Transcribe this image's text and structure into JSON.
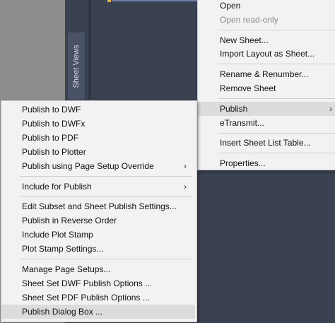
{
  "sheet_views_tab": "Sheet Views",
  "context_menu": {
    "items": [
      {
        "label": "Open"
      },
      {
        "label": "Open read-only"
      },
      {
        "label": "New Sheet..."
      },
      {
        "label": "Import Layout as Sheet..."
      },
      {
        "label": "Rename & Renumber..."
      },
      {
        "label": "Remove Sheet"
      },
      {
        "label": "Publish"
      },
      {
        "label": "eTransmit..."
      },
      {
        "label": "Insert Sheet List Table..."
      },
      {
        "label": "Properties..."
      }
    ]
  },
  "publish_submenu": {
    "items": [
      {
        "label": "Publish to DWF"
      },
      {
        "label": "Publish to DWFx"
      },
      {
        "label": "Publish to PDF"
      },
      {
        "label": "Publish to Plotter"
      },
      {
        "label": "Publish using Page Setup Override"
      },
      {
        "label": "Include for Publish"
      },
      {
        "label": "Edit Subset and Sheet Publish Settings..."
      },
      {
        "label": "Publish in Reverse Order"
      },
      {
        "label": "Include Plot Stamp"
      },
      {
        "label": "Plot Stamp Settings..."
      },
      {
        "label": "Manage Page Setups..."
      },
      {
        "label": "Sheet Set DWF Publish Options ..."
      },
      {
        "label": "Sheet Set PDF Publish Options ..."
      },
      {
        "label": "Publish Dialog Box ..."
      }
    ]
  },
  "icons": {
    "submenu_arrow": "chevron-right-icon",
    "marker": "yellow-marker"
  },
  "colors": {
    "panel": "#3a4252",
    "menu": "#f2f2f2",
    "hover": "#dcdcdc",
    "disabled_text": "#8a8a8a"
  }
}
